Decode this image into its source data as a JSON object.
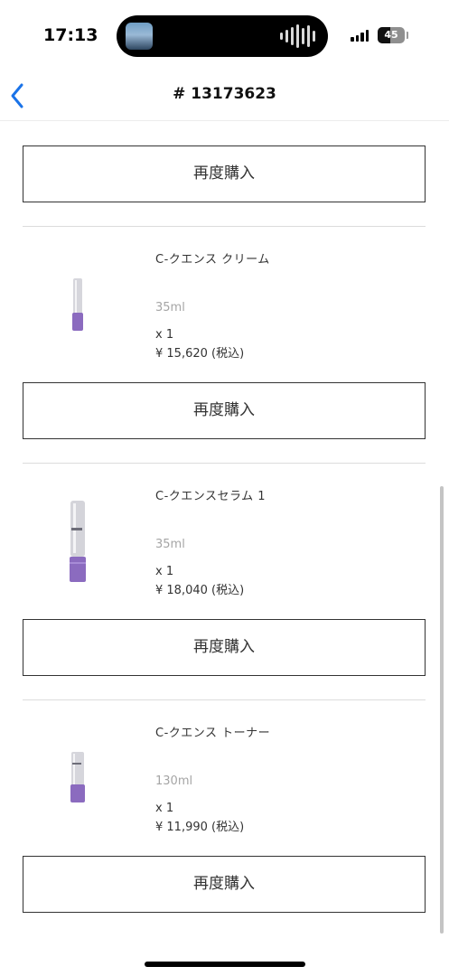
{
  "status_bar": {
    "time": "17:13",
    "battery": "45"
  },
  "nav": {
    "title": "# 13173623"
  },
  "rebuy_label": "再度購入",
  "products": [
    {
      "name": "C-クエンス クリーム",
      "size": "35ml",
      "qty": "x 1",
      "price": "¥ 15,620 (税込)"
    },
    {
      "name": "C-クエンスセラム 1",
      "size": "35ml",
      "qty": "x 1",
      "price": "¥ 18,040 (税込)"
    },
    {
      "name": "C-クエンス トーナー",
      "size": "130ml",
      "qty": "x 1",
      "price": "¥ 11,990 (税込)"
    }
  ],
  "colors": {
    "accent": "#1a73e8",
    "product_purple": "#8b6bbf"
  }
}
